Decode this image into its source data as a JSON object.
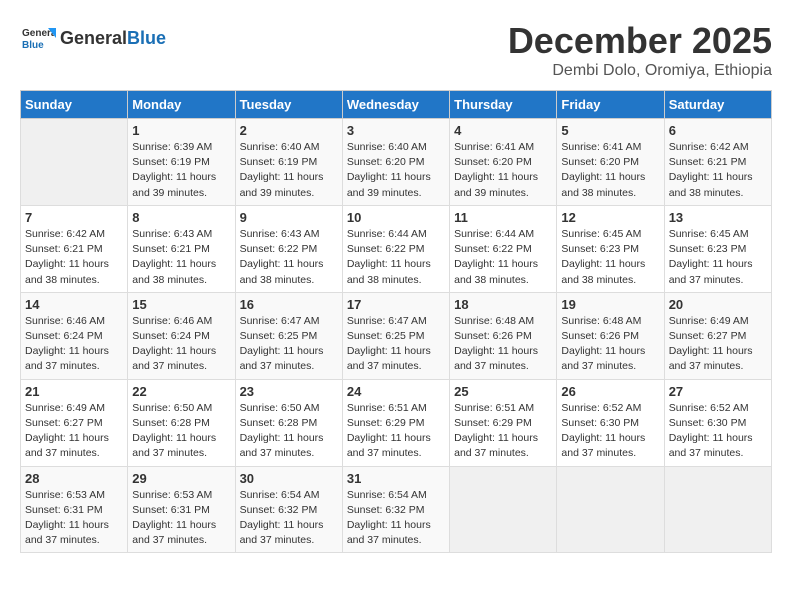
{
  "logo": {
    "general": "General",
    "blue": "Blue"
  },
  "header": {
    "month": "December 2025",
    "location": "Dembi Dolo, Oromiya, Ethiopia"
  },
  "weekdays": [
    "Sunday",
    "Monday",
    "Tuesday",
    "Wednesday",
    "Thursday",
    "Friday",
    "Saturday"
  ],
  "weeks": [
    [
      {
        "day": "",
        "info": ""
      },
      {
        "day": "1",
        "info": "Sunrise: 6:39 AM\nSunset: 6:19 PM\nDaylight: 11 hours\nand 39 minutes."
      },
      {
        "day": "2",
        "info": "Sunrise: 6:40 AM\nSunset: 6:19 PM\nDaylight: 11 hours\nand 39 minutes."
      },
      {
        "day": "3",
        "info": "Sunrise: 6:40 AM\nSunset: 6:20 PM\nDaylight: 11 hours\nand 39 minutes."
      },
      {
        "day": "4",
        "info": "Sunrise: 6:41 AM\nSunset: 6:20 PM\nDaylight: 11 hours\nand 39 minutes."
      },
      {
        "day": "5",
        "info": "Sunrise: 6:41 AM\nSunset: 6:20 PM\nDaylight: 11 hours\nand 38 minutes."
      },
      {
        "day": "6",
        "info": "Sunrise: 6:42 AM\nSunset: 6:21 PM\nDaylight: 11 hours\nand 38 minutes."
      }
    ],
    [
      {
        "day": "7",
        "info": "Sunrise: 6:42 AM\nSunset: 6:21 PM\nDaylight: 11 hours\nand 38 minutes."
      },
      {
        "day": "8",
        "info": "Sunrise: 6:43 AM\nSunset: 6:21 PM\nDaylight: 11 hours\nand 38 minutes."
      },
      {
        "day": "9",
        "info": "Sunrise: 6:43 AM\nSunset: 6:22 PM\nDaylight: 11 hours\nand 38 minutes."
      },
      {
        "day": "10",
        "info": "Sunrise: 6:44 AM\nSunset: 6:22 PM\nDaylight: 11 hours\nand 38 minutes."
      },
      {
        "day": "11",
        "info": "Sunrise: 6:44 AM\nSunset: 6:22 PM\nDaylight: 11 hours\nand 38 minutes."
      },
      {
        "day": "12",
        "info": "Sunrise: 6:45 AM\nSunset: 6:23 PM\nDaylight: 11 hours\nand 38 minutes."
      },
      {
        "day": "13",
        "info": "Sunrise: 6:45 AM\nSunset: 6:23 PM\nDaylight: 11 hours\nand 37 minutes."
      }
    ],
    [
      {
        "day": "14",
        "info": "Sunrise: 6:46 AM\nSunset: 6:24 PM\nDaylight: 11 hours\nand 37 minutes."
      },
      {
        "day": "15",
        "info": "Sunrise: 6:46 AM\nSunset: 6:24 PM\nDaylight: 11 hours\nand 37 minutes."
      },
      {
        "day": "16",
        "info": "Sunrise: 6:47 AM\nSunset: 6:25 PM\nDaylight: 11 hours\nand 37 minutes."
      },
      {
        "day": "17",
        "info": "Sunrise: 6:47 AM\nSunset: 6:25 PM\nDaylight: 11 hours\nand 37 minutes."
      },
      {
        "day": "18",
        "info": "Sunrise: 6:48 AM\nSunset: 6:26 PM\nDaylight: 11 hours\nand 37 minutes."
      },
      {
        "day": "19",
        "info": "Sunrise: 6:48 AM\nSunset: 6:26 PM\nDaylight: 11 hours\nand 37 minutes."
      },
      {
        "day": "20",
        "info": "Sunrise: 6:49 AM\nSunset: 6:27 PM\nDaylight: 11 hours\nand 37 minutes."
      }
    ],
    [
      {
        "day": "21",
        "info": "Sunrise: 6:49 AM\nSunset: 6:27 PM\nDaylight: 11 hours\nand 37 minutes."
      },
      {
        "day": "22",
        "info": "Sunrise: 6:50 AM\nSunset: 6:28 PM\nDaylight: 11 hours\nand 37 minutes."
      },
      {
        "day": "23",
        "info": "Sunrise: 6:50 AM\nSunset: 6:28 PM\nDaylight: 11 hours\nand 37 minutes."
      },
      {
        "day": "24",
        "info": "Sunrise: 6:51 AM\nSunset: 6:29 PM\nDaylight: 11 hours\nand 37 minutes."
      },
      {
        "day": "25",
        "info": "Sunrise: 6:51 AM\nSunset: 6:29 PM\nDaylight: 11 hours\nand 37 minutes."
      },
      {
        "day": "26",
        "info": "Sunrise: 6:52 AM\nSunset: 6:30 PM\nDaylight: 11 hours\nand 37 minutes."
      },
      {
        "day": "27",
        "info": "Sunrise: 6:52 AM\nSunset: 6:30 PM\nDaylight: 11 hours\nand 37 minutes."
      }
    ],
    [
      {
        "day": "28",
        "info": "Sunrise: 6:53 AM\nSunset: 6:31 PM\nDaylight: 11 hours\nand 37 minutes."
      },
      {
        "day": "29",
        "info": "Sunrise: 6:53 AM\nSunset: 6:31 PM\nDaylight: 11 hours\nand 37 minutes."
      },
      {
        "day": "30",
        "info": "Sunrise: 6:54 AM\nSunset: 6:32 PM\nDaylight: 11 hours\nand 37 minutes."
      },
      {
        "day": "31",
        "info": "Sunrise: 6:54 AM\nSunset: 6:32 PM\nDaylight: 11 hours\nand 37 minutes."
      },
      {
        "day": "",
        "info": ""
      },
      {
        "day": "",
        "info": ""
      },
      {
        "day": "",
        "info": ""
      }
    ]
  ]
}
